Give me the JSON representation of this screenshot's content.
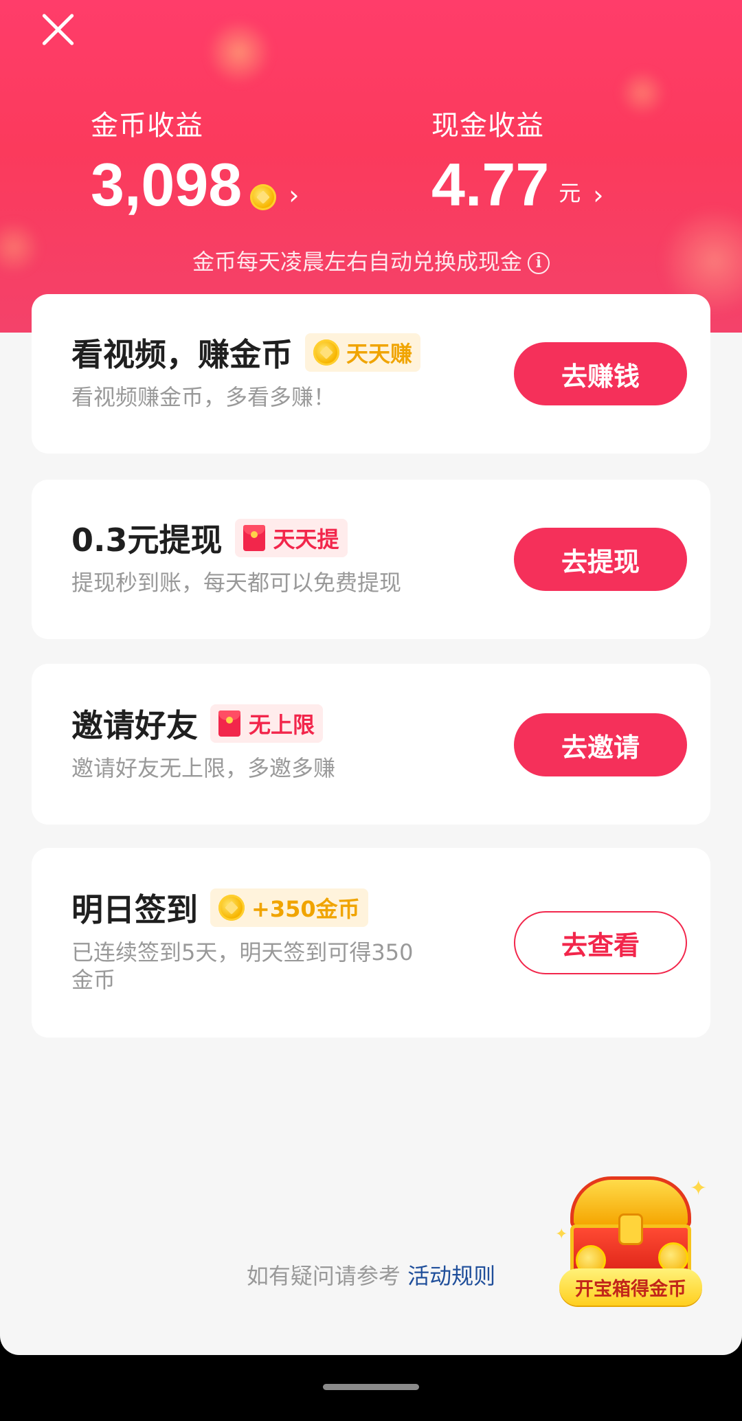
{
  "header": {
    "coin_label": "金币收益",
    "coin_value": "3,098",
    "cash_label": "现金收益",
    "cash_value": "4.77",
    "cash_unit": "元",
    "chevron": "›",
    "note": "金币每天凌晨左右自动兑换成现金",
    "info_icon_glyph": "i"
  },
  "cards": [
    {
      "title": "看视频，赚金币",
      "tag": "天天赚",
      "tag_icon": "coin-icon",
      "subtitle": "看视频赚金币，多看多赚！",
      "button": "去赚钱"
    },
    {
      "title": "0.3元提现",
      "tag": "天天提",
      "tag_icon": "red-packet-icon",
      "subtitle": "提现秒到账，每天都可以免费提现",
      "button": "去提现"
    },
    {
      "title": "邀请好友",
      "tag": "无上限",
      "tag_icon": "red-packet-icon",
      "subtitle": "邀请好友无上限，多邀多赚",
      "button": "去邀请"
    },
    {
      "title": "明日签到",
      "tag": "+350金币",
      "tag_icon": "coin-icon",
      "subtitle_line1": "已连续签到5天，明天签到可得350",
      "subtitle_line2": "金币",
      "button": "去查看"
    }
  ],
  "footer": {
    "rules_prefix": "如有疑问请参考",
    "rules_link": "活动规则"
  },
  "treasure": {
    "label": "开宝箱得金币"
  },
  "colors": {
    "brand_red": "#f5305a",
    "gold": "#f0a400",
    "link_blue": "#1f4e9a"
  }
}
